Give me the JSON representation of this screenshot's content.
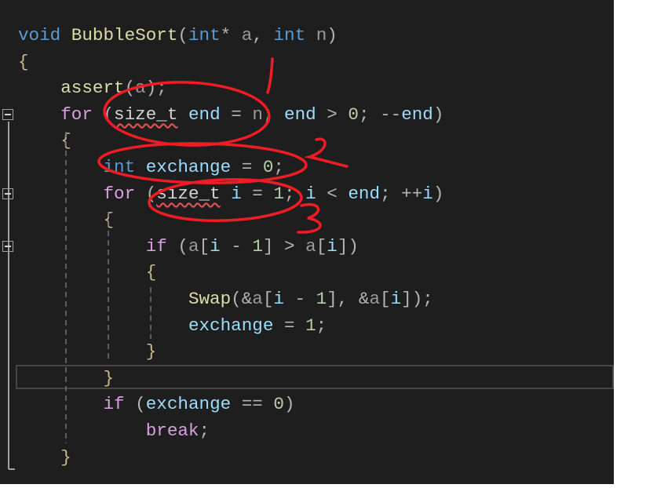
{
  "editor": {
    "lines": [
      [
        [
          "kw",
          "void "
        ],
        [
          "fn",
          "BubbleSort"
        ],
        [
          "p",
          "("
        ],
        [
          "kw",
          "int"
        ],
        [
          "p",
          "* "
        ],
        [
          "prm",
          "a"
        ],
        [
          "p",
          ", "
        ],
        [
          "kw",
          "int "
        ],
        [
          "prm",
          "n"
        ],
        [
          "p",
          ")"
        ]
      ],
      [
        [
          "br",
          "{"
        ]
      ],
      [
        [
          "p",
          "    "
        ],
        [
          "fn",
          "assert"
        ],
        [
          "p",
          "("
        ],
        [
          "prm",
          "a"
        ],
        [
          "p",
          ");"
        ]
      ],
      [
        [
          "p",
          "    "
        ],
        [
          "ctl",
          "for "
        ],
        [
          "p",
          "("
        ],
        [
          "ty",
          "size_t"
        ],
        [
          "p",
          " "
        ],
        [
          "var",
          "end"
        ],
        [
          "p",
          " = "
        ],
        [
          "prm",
          "n"
        ],
        [
          "p",
          "; "
        ],
        [
          "var",
          "end"
        ],
        [
          "p",
          " > "
        ],
        [
          "num",
          "0"
        ],
        [
          "p",
          "; --"
        ],
        [
          "var",
          "end"
        ],
        [
          "p",
          ")"
        ]
      ],
      [
        [
          "p",
          "    "
        ],
        [
          "br",
          "{"
        ]
      ],
      [
        [
          "p",
          "        "
        ],
        [
          "kw",
          "int "
        ],
        [
          "var",
          "exchange"
        ],
        [
          "p",
          " = "
        ],
        [
          "num",
          "0"
        ],
        [
          "p",
          ";"
        ]
      ],
      [
        [
          "p",
          "        "
        ],
        [
          "ctl",
          "for "
        ],
        [
          "p",
          "("
        ],
        [
          "ty",
          "size_t"
        ],
        [
          "p",
          " "
        ],
        [
          "var",
          "i"
        ],
        [
          "p",
          " = "
        ],
        [
          "num",
          "1"
        ],
        [
          "p",
          "; "
        ],
        [
          "var",
          "i"
        ],
        [
          "p",
          " < "
        ],
        [
          "var",
          "end"
        ],
        [
          "p",
          "; ++"
        ],
        [
          "var",
          "i"
        ],
        [
          "p",
          ")"
        ]
      ],
      [
        [
          "p",
          "        "
        ],
        [
          "br",
          "{"
        ]
      ],
      [
        [
          "p",
          "            "
        ],
        [
          "ctl",
          "if "
        ],
        [
          "p",
          "("
        ],
        [
          "prm",
          "a"
        ],
        [
          "p",
          "["
        ],
        [
          "var",
          "i"
        ],
        [
          "p",
          " - "
        ],
        [
          "num",
          "1"
        ],
        [
          "p",
          "] > "
        ],
        [
          "prm",
          "a"
        ],
        [
          "p",
          "["
        ],
        [
          "var",
          "i"
        ],
        [
          "p",
          "])"
        ]
      ],
      [
        [
          "p",
          "            "
        ],
        [
          "br",
          "{"
        ]
      ],
      [
        [
          "p",
          "                "
        ],
        [
          "fn",
          "Swap"
        ],
        [
          "p",
          "(&"
        ],
        [
          "prm",
          "a"
        ],
        [
          "p",
          "["
        ],
        [
          "var",
          "i"
        ],
        [
          "p",
          " - "
        ],
        [
          "num",
          "1"
        ],
        [
          "p",
          "], &"
        ],
        [
          "prm",
          "a"
        ],
        [
          "p",
          "["
        ],
        [
          "var",
          "i"
        ],
        [
          "p",
          "]);"
        ]
      ],
      [
        [
          "p",
          "                "
        ],
        [
          "var",
          "exchange"
        ],
        [
          "p",
          " = "
        ],
        [
          "num",
          "1"
        ],
        [
          "p",
          ";"
        ]
      ],
      [
        [
          "p",
          "            "
        ],
        [
          "br",
          "}"
        ]
      ],
      [
        [
          "p",
          "        "
        ],
        [
          "br",
          "}"
        ]
      ],
      [
        [
          "p",
          "        "
        ],
        [
          "ctl",
          "if "
        ],
        [
          "p",
          "("
        ],
        [
          "var",
          "exchange"
        ],
        [
          "p",
          " == "
        ],
        [
          "num",
          "0"
        ],
        [
          "p",
          ")"
        ]
      ],
      [
        [
          "p",
          "            "
        ],
        [
          "ctl",
          "break"
        ],
        [
          "p",
          ";"
        ]
      ],
      [
        [
          "p",
          "    "
        ],
        [
          "br",
          "}"
        ]
      ]
    ],
    "fold_lines": [
      3,
      6,
      8
    ],
    "current_line": 13
  },
  "annotations": {
    "color": "#ee1c24",
    "labels": [
      "1",
      "2",
      "3"
    ]
  },
  "colors": {
    "background": "#1e1e1e",
    "keyword": "#569cd6",
    "control": "#d8a0df",
    "variable": "#9cdcfe",
    "function": "#dcdcaa",
    "number": "#b5cea8"
  }
}
